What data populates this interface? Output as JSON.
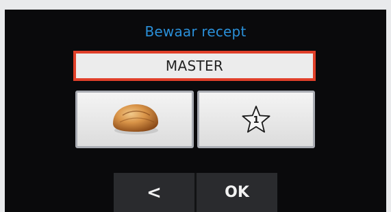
{
  "screen": {
    "title": "Bewaar recept",
    "recipe_name": "MASTER",
    "options": [
      {
        "icon": "bread-roll-icon"
      },
      {
        "icon": "star-icon",
        "number": "1"
      }
    ],
    "nav": {
      "back_label": "<",
      "ok_label": "OK"
    }
  },
  "colors": {
    "title": "#2a8fd8",
    "field_border": "#e0402a",
    "background": "#0a0a0c"
  }
}
